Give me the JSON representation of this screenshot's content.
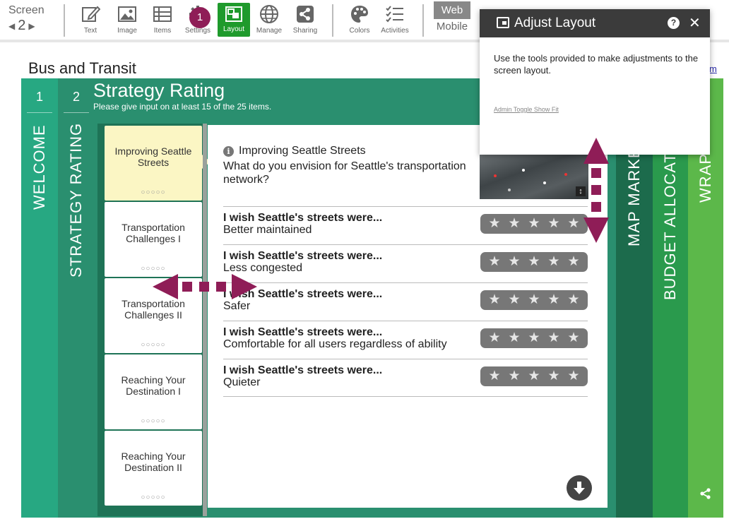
{
  "toolbar": {
    "screen_label": "Screen",
    "screen_number": "2",
    "buttons": [
      {
        "label": "Text",
        "icon": "pencil-icon"
      },
      {
        "label": "Image",
        "icon": "image-icon"
      },
      {
        "label": "Items",
        "icon": "list-icon"
      },
      {
        "label": "Settings",
        "icon": "gear-icon"
      },
      {
        "label": "Layout",
        "icon": "layout-icon",
        "active": true
      },
      {
        "label": "Manage",
        "icon": "globe-icon"
      },
      {
        "label": "Sharing",
        "icon": "share-icon"
      },
      {
        "label": "Colors",
        "icon": "palette-icon"
      },
      {
        "label": "Activities",
        "icon": "checklist-icon"
      }
    ],
    "badge": "1",
    "web_label": "Web",
    "mobile_label": "Mobile"
  },
  "page": {
    "title": "Bus and Transit",
    "right_link": "m"
  },
  "panels": {
    "welcome": {
      "number": "1",
      "label": "WELCOME"
    },
    "strategy": {
      "number": "2",
      "label": "STRATEGY RATING",
      "title": "Strategy Rating",
      "subtitle": "Please give input on at least 15 of the 25 items."
    },
    "map": {
      "label": "MAP MARKE"
    },
    "budget": {
      "label": "BUDGET ALLOCAT"
    },
    "wrap": {
      "label": "WRAP"
    }
  },
  "list_items": [
    {
      "label": "Improving Seattle Streets",
      "dots": "○○○○○",
      "selected": true
    },
    {
      "label": "Transportation Challenges I",
      "dots": "○○○○○"
    },
    {
      "label": "Transportation Challenges II",
      "dots": "○○○○○"
    },
    {
      "label": "Reaching Your Destination I",
      "dots": "○○○○○"
    },
    {
      "label": "Reaching Your Destination II",
      "dots": "○○○○○"
    }
  ],
  "question": {
    "info_glyph": "i",
    "title": "Improving Seattle Streets",
    "text": "What do you envision for Seattle's transportation network?"
  },
  "rating_rows": [
    {
      "head": "I wish Seattle's streets were...",
      "sub": "Better maintained"
    },
    {
      "head": "I wish Seattle's streets were...",
      "sub": "Less congested"
    },
    {
      "head": "I wish Seattle's streets were...",
      "sub": "Safer"
    },
    {
      "head": "I wish Seattle's streets were...",
      "sub": "Comfortable for all users regardless of ability"
    },
    {
      "head": "I wish Seattle's streets were...",
      "sub": "Quieter"
    }
  ],
  "dialog": {
    "title": "Adjust Layout",
    "help": "?",
    "close": "✕",
    "body": "Use the tools provided to make adjustments to the screen layout.",
    "link": "Admin Toggle Show Fit"
  },
  "colors": {
    "active_green": "#1f9a2c",
    "badge": "#8f1d57",
    "arrow": "#8f1d57",
    "welcome": "#27a882",
    "strategy": "#2a8f6f",
    "map": "#1c6b4c",
    "budget": "#2a9a4d",
    "wrap": "#5cb84a"
  }
}
